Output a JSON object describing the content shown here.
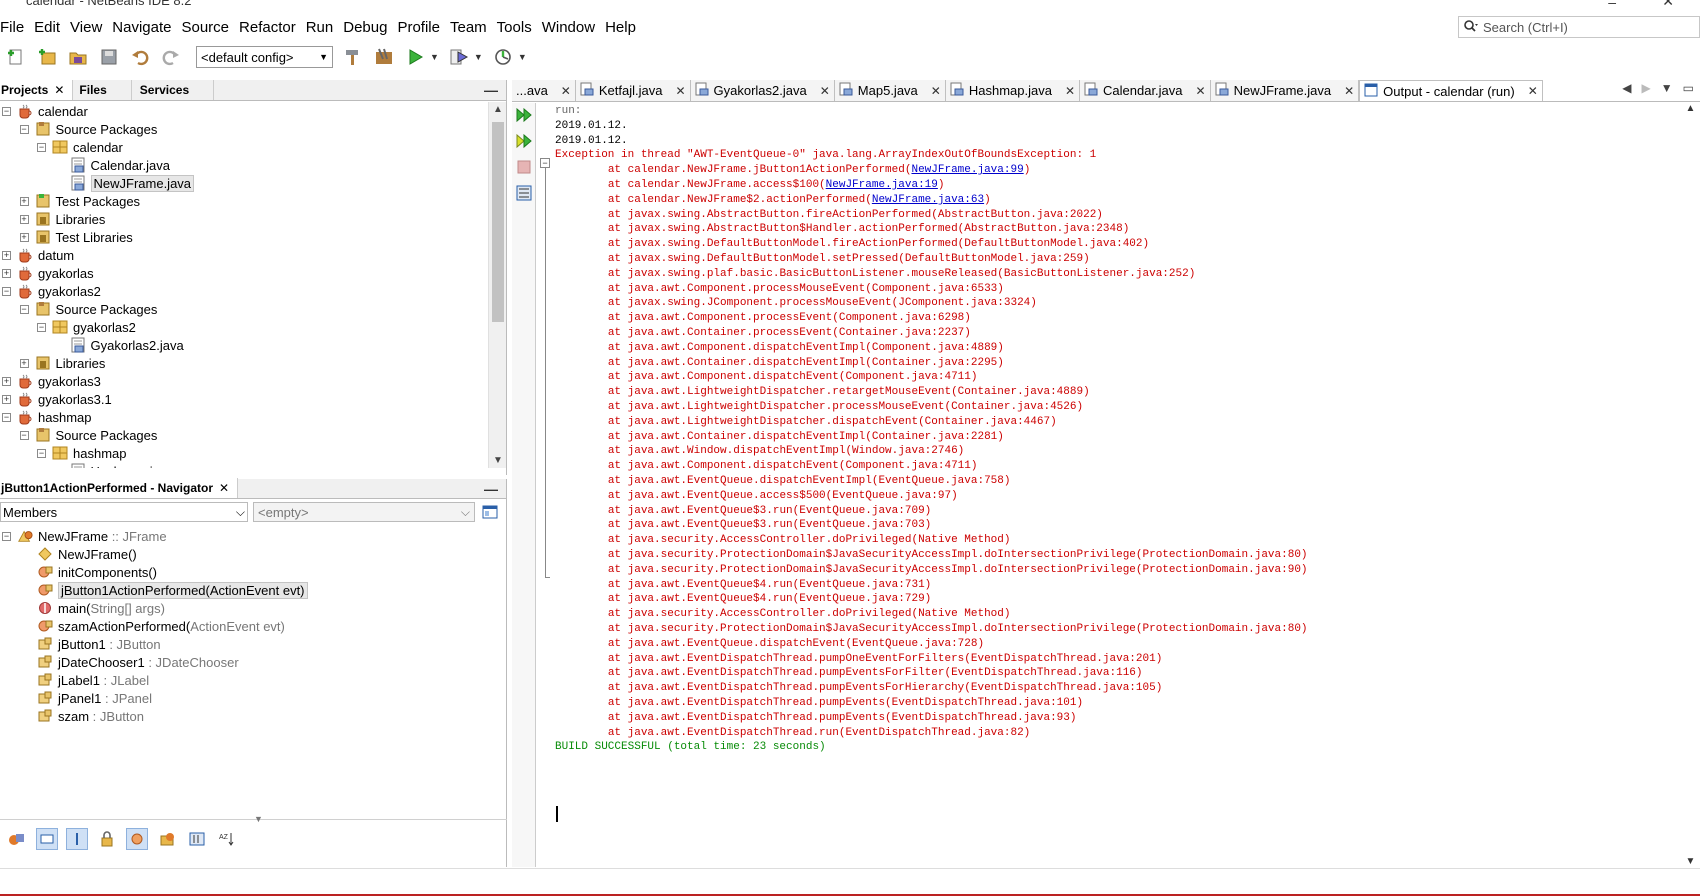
{
  "window": {
    "title": "calendar - NetBeans IDE 8.2"
  },
  "menu": [
    "File",
    "Edit",
    "View",
    "Navigate",
    "Source",
    "Refactor",
    "Run",
    "Debug",
    "Profile",
    "Team",
    "Tools",
    "Window",
    "Help"
  ],
  "search": {
    "placeholder": "Search (Ctrl+I)"
  },
  "toolbar": {
    "config": "<default config>"
  },
  "projects_panel": {
    "tabs": [
      "Projects",
      "Files",
      "Services"
    ],
    "tree": [
      {
        "label": "calendar",
        "depth": 0,
        "toggle": "-",
        "icon": "project-icon"
      },
      {
        "label": "Source Packages",
        "depth": 1,
        "toggle": "-",
        "icon": "source-packages-icon"
      },
      {
        "label": "calendar",
        "depth": 2,
        "toggle": "-",
        "icon": "package-icon"
      },
      {
        "label": "Calendar.java",
        "depth": 3,
        "toggle": "",
        "icon": "java-file-icon"
      },
      {
        "label": "NewJFrame.java",
        "depth": 3,
        "toggle": "",
        "icon": "java-file-icon",
        "selected": true
      },
      {
        "label": "Test Packages",
        "depth": 1,
        "toggle": "+",
        "icon": "test-packages-icon"
      },
      {
        "label": "Libraries",
        "depth": 1,
        "toggle": "+",
        "icon": "libraries-icon"
      },
      {
        "label": "Test Libraries",
        "depth": 1,
        "toggle": "+",
        "icon": "libraries-icon"
      },
      {
        "label": "datum",
        "depth": 0,
        "toggle": "+",
        "icon": "project-icon"
      },
      {
        "label": "gyakorlas",
        "depth": 0,
        "toggle": "+",
        "icon": "project-icon"
      },
      {
        "label": "gyakorlas2",
        "depth": 0,
        "toggle": "-",
        "icon": "project-icon"
      },
      {
        "label": "Source Packages",
        "depth": 1,
        "toggle": "-",
        "icon": "source-packages-icon"
      },
      {
        "label": "gyakorlas2",
        "depth": 2,
        "toggle": "-",
        "icon": "package-icon"
      },
      {
        "label": "Gyakorlas2.java",
        "depth": 3,
        "toggle": "",
        "icon": "java-file-icon"
      },
      {
        "label": "Libraries",
        "depth": 1,
        "toggle": "+",
        "icon": "libraries-icon"
      },
      {
        "label": "gyakorlas3",
        "depth": 0,
        "toggle": "+",
        "icon": "project-icon"
      },
      {
        "label": "gyakorlas3.1",
        "depth": 0,
        "toggle": "+",
        "icon": "project-icon"
      },
      {
        "label": "hashmap",
        "depth": 0,
        "toggle": "-",
        "icon": "project-icon"
      },
      {
        "label": "Source Packages",
        "depth": 1,
        "toggle": "-",
        "icon": "source-packages-icon"
      },
      {
        "label": "hashmap",
        "depth": 2,
        "toggle": "-",
        "icon": "package-icon"
      },
      {
        "label": "Hashmap.java",
        "depth": 3,
        "toggle": "",
        "icon": "java-file-icon"
      }
    ]
  },
  "navigator": {
    "title": "jButton1ActionPerformed - Navigator",
    "members_select": "Members",
    "filter_select": "<empty>",
    "items": [
      {
        "name": "NewJFrame",
        "type": " :: JFrame",
        "icon": "class-icon",
        "root": true
      },
      {
        "name": "NewJFrame()",
        "type": "",
        "icon": "constructor-icon"
      },
      {
        "name": "initComponents()",
        "type": "",
        "icon": "private-method-icon"
      },
      {
        "name": "jButton1ActionPerformed(ActionEvent evt)",
        "type": "",
        "icon": "private-method-icon",
        "selected": true
      },
      {
        "name": "main(",
        "type": "String[] args)",
        "icon": "static-method-icon",
        "suffix_dark": " args)"
      },
      {
        "name": "szamActionPerformed(",
        "type": "ActionEvent evt)",
        "icon": "private-method-icon"
      },
      {
        "name": "jButton1",
        "type": " : JButton",
        "icon": "field-icon"
      },
      {
        "name": "jDateChooser1",
        "type": " : JDateChooser",
        "icon": "field-icon"
      },
      {
        "name": "jLabel1",
        "type": " : JLabel",
        "icon": "field-icon"
      },
      {
        "name": "jPanel1",
        "type": " : JPanel",
        "icon": "field-icon"
      },
      {
        "name": "szam",
        "type": " : JButton",
        "icon": "field-icon"
      }
    ]
  },
  "editor_tabs": [
    {
      "label": "...ava"
    },
    {
      "label": "Ketfajl.java"
    },
    {
      "label": "Gyakorlas2.java"
    },
    {
      "label": "Map5.java"
    },
    {
      "label": "Hashmap.java"
    },
    {
      "label": "Calendar.java"
    },
    {
      "label": "NewJFrame.java"
    },
    {
      "label": "Output - calendar (run)",
      "active": true
    }
  ],
  "output": {
    "lines": [
      {
        "cls": "gray",
        "pre": "run:"
      },
      {
        "cls": "blk",
        "pre": "2019.01.12."
      },
      {
        "cls": "blk",
        "pre": "2019.01.12."
      },
      {
        "cls": "red",
        "pre": "Exception in thread \"AWT-EventQueue-0\" java.lang.ArrayIndexOutOfBoundsException: 1"
      },
      {
        "cls": "red",
        "pre": "\tat calendar.NewJFrame.jButton1ActionPerformed(",
        "link": "NewJFrame.java:99",
        "post": ")"
      },
      {
        "cls": "red",
        "pre": "\tat calendar.NewJFrame.access$100(",
        "link": "NewJFrame.java:19",
        "post": ")"
      },
      {
        "cls": "red",
        "pre": "\tat calendar.NewJFrame$2.actionPerformed(",
        "link": "NewJFrame.java:63",
        "post": ")"
      },
      {
        "cls": "red",
        "pre": "\tat javax.swing.AbstractButton.fireActionPerformed(AbstractButton.java:2022)"
      },
      {
        "cls": "red",
        "pre": "\tat javax.swing.AbstractButton$Handler.actionPerformed(AbstractButton.java:2348)"
      },
      {
        "cls": "red",
        "pre": "\tat javax.swing.DefaultButtonModel.fireActionPerformed(DefaultButtonModel.java:402)"
      },
      {
        "cls": "red",
        "pre": "\tat javax.swing.DefaultButtonModel.setPressed(DefaultButtonModel.java:259)"
      },
      {
        "cls": "red",
        "pre": "\tat javax.swing.plaf.basic.BasicButtonListener.mouseReleased(BasicButtonListener.java:252)"
      },
      {
        "cls": "red",
        "pre": "\tat java.awt.Component.processMouseEvent(Component.java:6533)"
      },
      {
        "cls": "red",
        "pre": "\tat javax.swing.JComponent.processMouseEvent(JComponent.java:3324)"
      },
      {
        "cls": "red",
        "pre": "\tat java.awt.Component.processEvent(Component.java:6298)"
      },
      {
        "cls": "red",
        "pre": "\tat java.awt.Container.processEvent(Container.java:2237)"
      },
      {
        "cls": "red",
        "pre": "\tat java.awt.Component.dispatchEventImpl(Component.java:4889)"
      },
      {
        "cls": "red",
        "pre": "\tat java.awt.Container.dispatchEventImpl(Container.java:2295)"
      },
      {
        "cls": "red",
        "pre": "\tat java.awt.Component.dispatchEvent(Component.java:4711)"
      },
      {
        "cls": "red",
        "pre": "\tat java.awt.LightweightDispatcher.retargetMouseEvent(Container.java:4889)"
      },
      {
        "cls": "red",
        "pre": "\tat java.awt.LightweightDispatcher.processMouseEvent(Container.java:4526)"
      },
      {
        "cls": "red",
        "pre": "\tat java.awt.LightweightDispatcher.dispatchEvent(Container.java:4467)"
      },
      {
        "cls": "red",
        "pre": "\tat java.awt.Container.dispatchEventImpl(Container.java:2281)"
      },
      {
        "cls": "red",
        "pre": "\tat java.awt.Window.dispatchEventImpl(Window.java:2746)"
      },
      {
        "cls": "red",
        "pre": "\tat java.awt.Component.dispatchEvent(Component.java:4711)"
      },
      {
        "cls": "red",
        "pre": "\tat java.awt.EventQueue.dispatchEventImpl(EventQueue.java:758)"
      },
      {
        "cls": "red",
        "pre": "\tat java.awt.EventQueue.access$500(EventQueue.java:97)"
      },
      {
        "cls": "red",
        "pre": "\tat java.awt.EventQueue$3.run(EventQueue.java:709)"
      },
      {
        "cls": "red",
        "pre": "\tat java.awt.EventQueue$3.run(EventQueue.java:703)"
      },
      {
        "cls": "red",
        "pre": "\tat java.security.AccessController.doPrivileged(Native Method)"
      },
      {
        "cls": "red",
        "pre": "\tat java.security.ProtectionDomain$JavaSecurityAccessImpl.doIntersectionPrivilege(ProtectionDomain.java:80)"
      },
      {
        "cls": "red",
        "pre": "\tat java.security.ProtectionDomain$JavaSecurityAccessImpl.doIntersectionPrivilege(ProtectionDomain.java:90)"
      },
      {
        "cls": "red",
        "pre": "\tat java.awt.EventQueue$4.run(EventQueue.java:731)"
      },
      {
        "cls": "red",
        "pre": "\tat java.awt.EventQueue$4.run(EventQueue.java:729)"
      },
      {
        "cls": "red",
        "pre": "\tat java.security.AccessController.doPrivileged(Native Method)"
      },
      {
        "cls": "red",
        "pre": "\tat java.security.ProtectionDomain$JavaSecurityAccessImpl.doIntersectionPrivilege(ProtectionDomain.java:80)"
      },
      {
        "cls": "red",
        "pre": "\tat java.awt.EventQueue.dispatchEvent(EventQueue.java:728)"
      },
      {
        "cls": "red",
        "pre": "\tat java.awt.EventDispatchThread.pumpOneEventForFilters(EventDispatchThread.java:201)"
      },
      {
        "cls": "red",
        "pre": "\tat java.awt.EventDispatchThread.pumpEventsForFilter(EventDispatchThread.java:116)"
      },
      {
        "cls": "red",
        "pre": "\tat java.awt.EventDispatchThread.pumpEventsForHierarchy(EventDispatchThread.java:105)"
      },
      {
        "cls": "red",
        "pre": "\tat java.awt.EventDispatchThread.pumpEvents(EventDispatchThread.java:101)"
      },
      {
        "cls": "red",
        "pre": "\tat java.awt.EventDispatchThread.pumpEvents(EventDispatchThread.java:93)"
      },
      {
        "cls": "red",
        "pre": "\tat java.awt.EventDispatchThread.run(EventDispatchThread.java:82)"
      },
      {
        "cls": "grn",
        "pre": "BUILD SUCCESSFUL (total time: 23 seconds)"
      }
    ]
  },
  "colors": {
    "error_text": "#cc0000",
    "success_text": "#078b07",
    "link": "#0000cc"
  }
}
